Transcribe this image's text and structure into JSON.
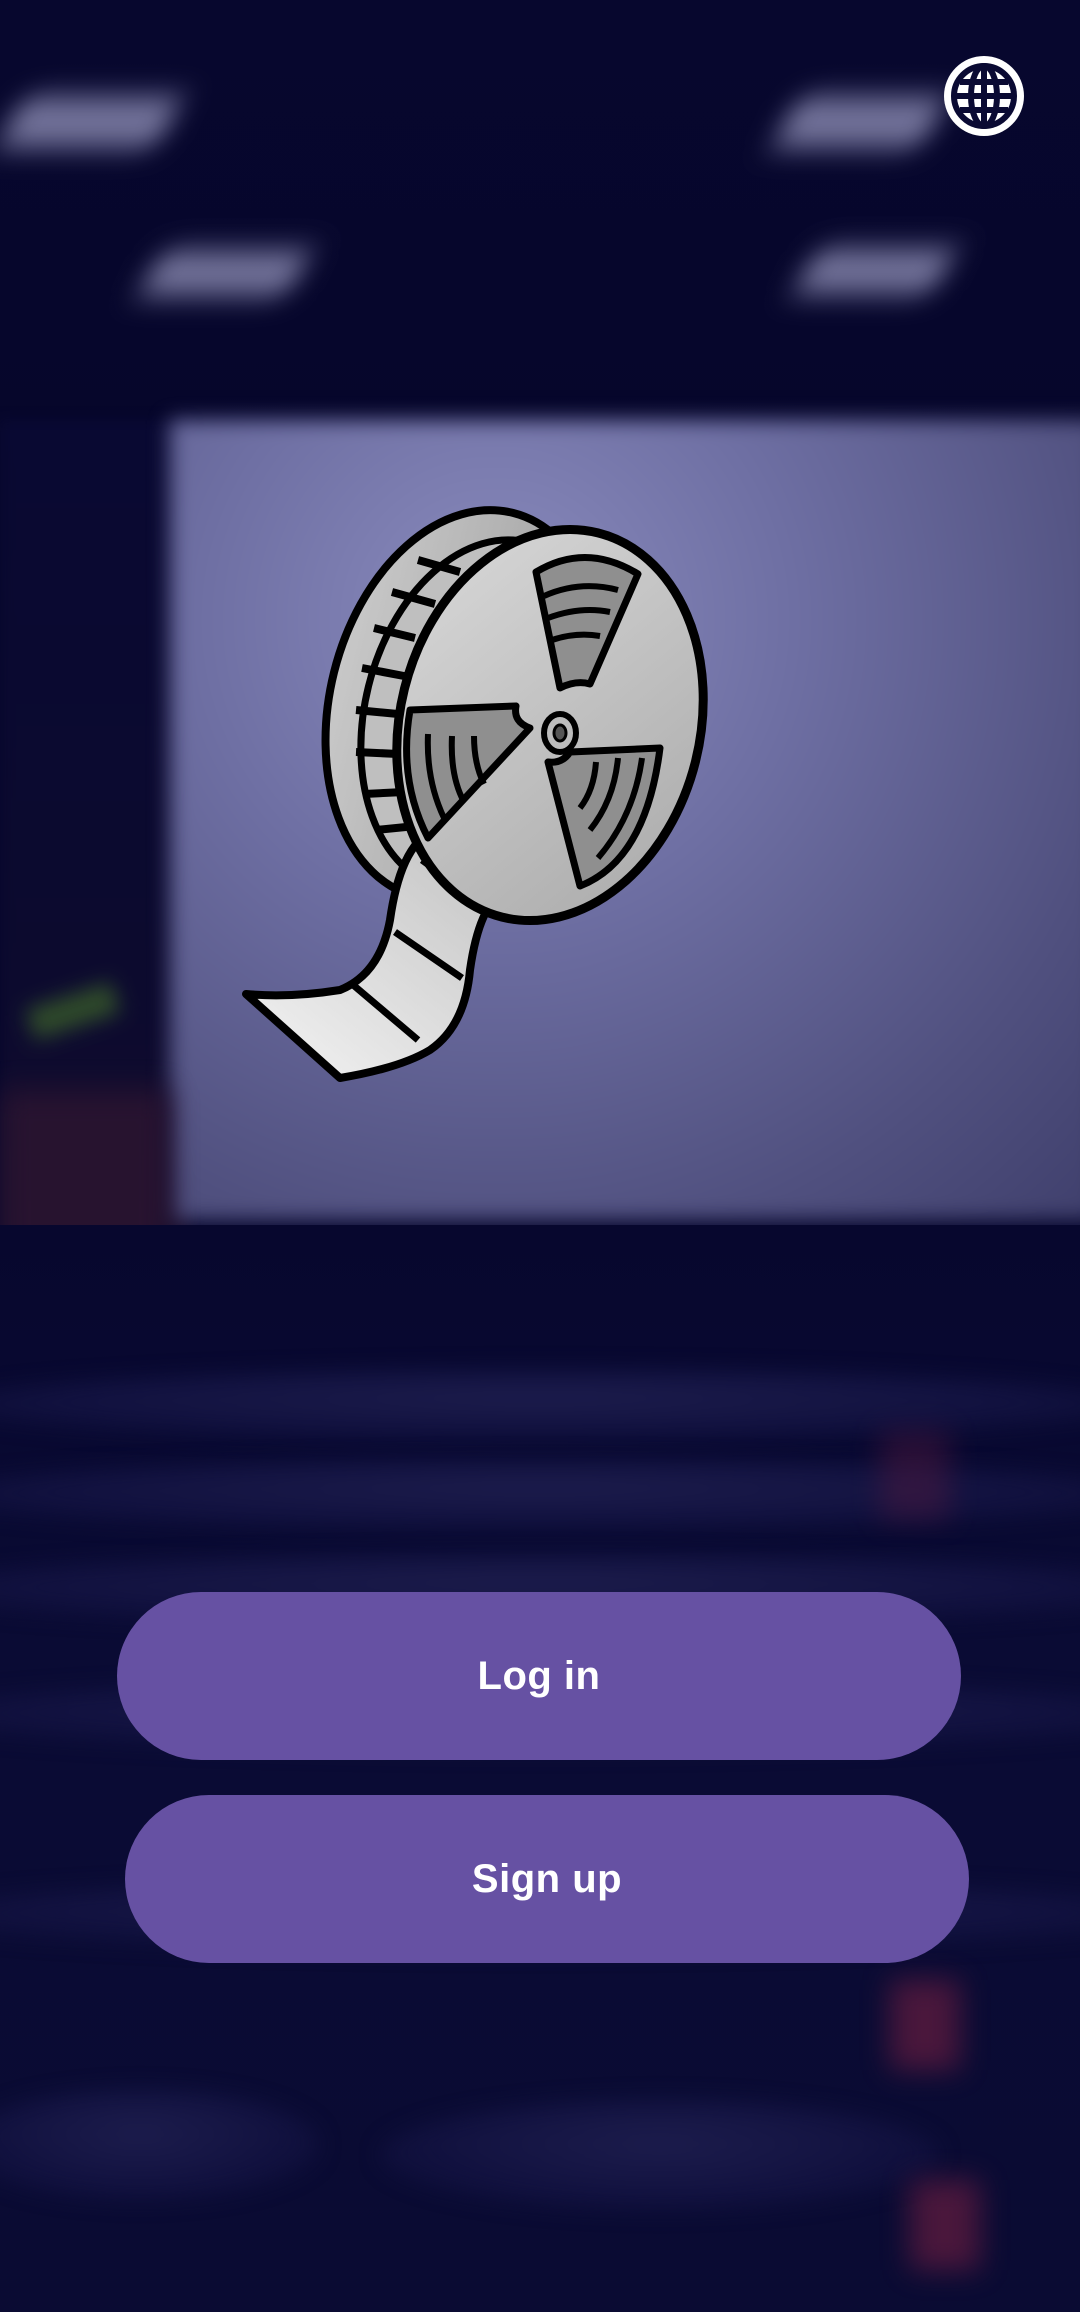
{
  "header": {
    "language_icon": "globe-icon"
  },
  "logo": {
    "icon": "film-reel-icon"
  },
  "actions": {
    "login_label": "Log in",
    "signup_label": "Sign up"
  },
  "colors": {
    "button_bg": "#6651a3",
    "button_text": "#ffffff",
    "background": "#06062c"
  }
}
